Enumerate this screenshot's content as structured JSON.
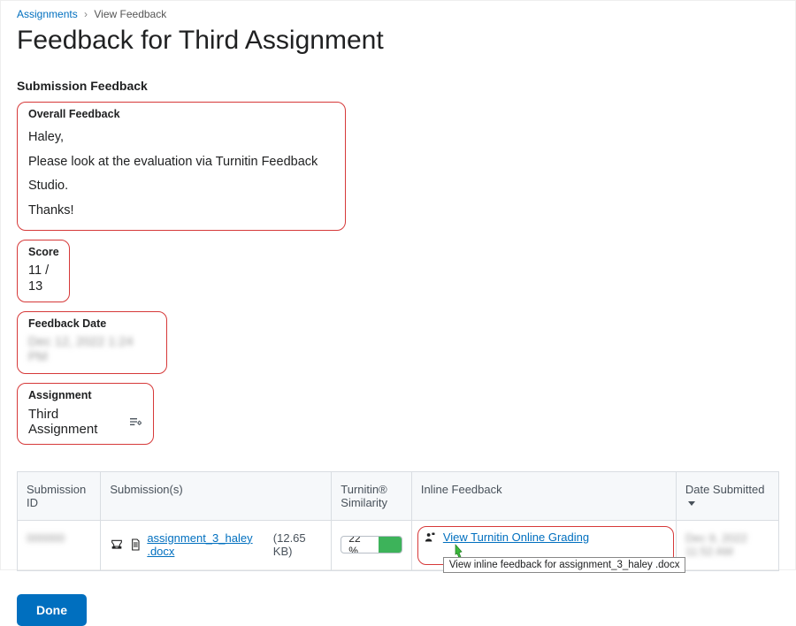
{
  "breadcrumb": {
    "parent": "Assignments",
    "current": "View Feedback"
  },
  "page_title": "Feedback for Third Assignment",
  "submission_feedback_heading": "Submission Feedback",
  "overall_feedback": {
    "label": "Overall Feedback",
    "line1": "Haley,",
    "line2": "Please look at the evaluation via Turnitin Feedback Studio.",
    "line3": "Thanks!"
  },
  "score": {
    "label": "Score",
    "value": "11 / 13"
  },
  "feedback_date": {
    "label": "Feedback Date",
    "value": "Dec 12, 2022 1:24 PM"
  },
  "assignment": {
    "label": "Assignment",
    "value": "Third Assignment"
  },
  "table": {
    "headers": {
      "submission_id": "Submission ID",
      "submissions": "Submission(s)",
      "turnitin_similarity": "Turnitin® Similarity",
      "inline_feedback": "Inline Feedback",
      "date_submitted": "Date Submitted"
    },
    "row": {
      "submission_id": "000000",
      "file_name": "assignment_3_haley .docx",
      "file_size": "(12.65 KB)",
      "similarity_pct": "22 %",
      "inline_link": "View Turnitin Online Grading",
      "tooltip": "View inline feedback for assignment_3_haley .docx",
      "date_submitted": "Dec 9, 2022 11:52 AM"
    }
  },
  "done_button": "Done"
}
